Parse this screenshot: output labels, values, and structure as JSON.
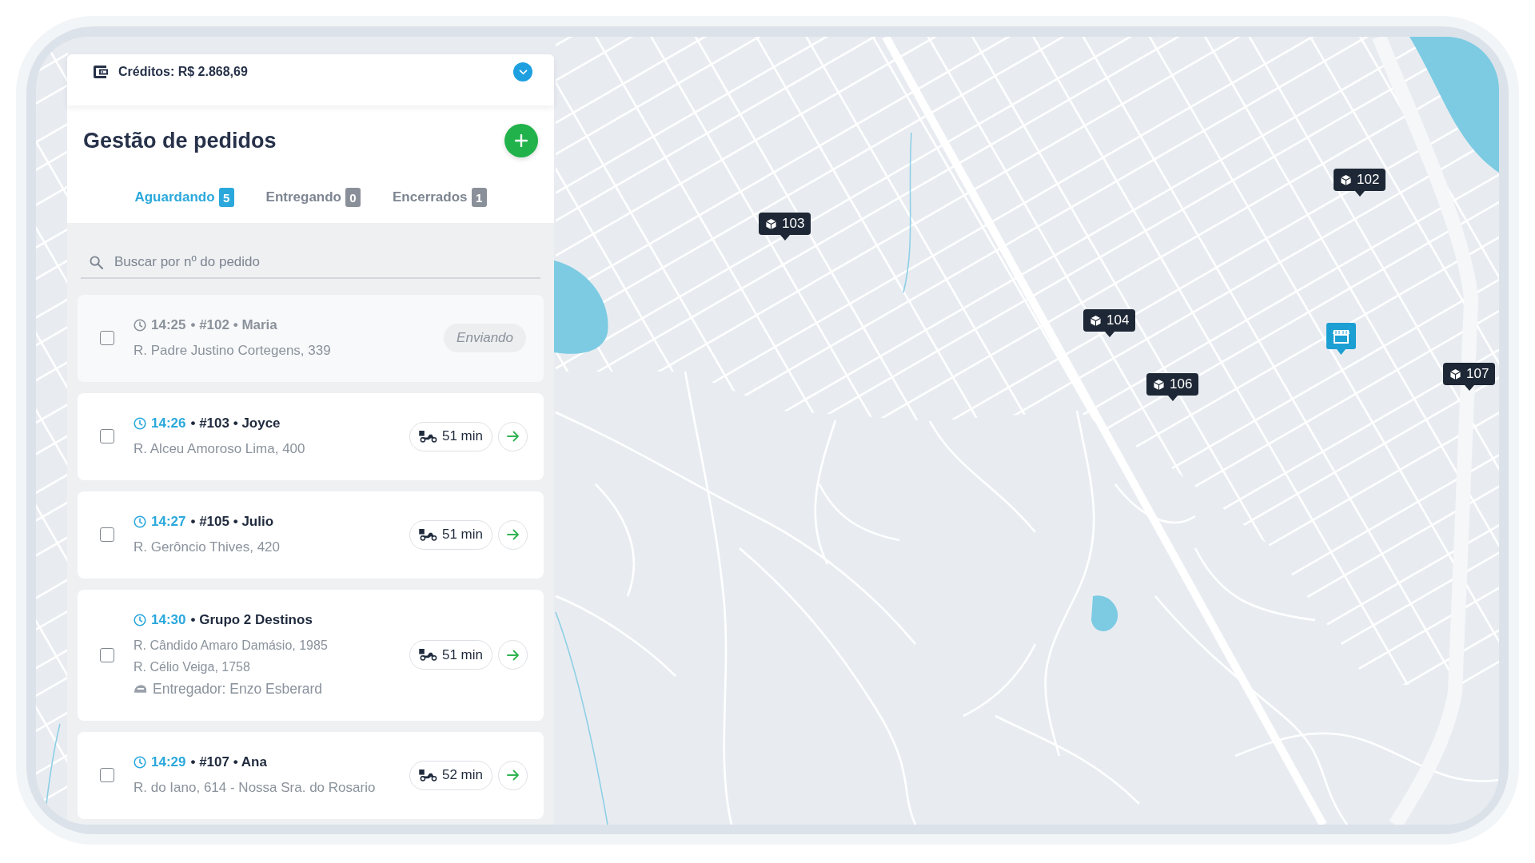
{
  "credits": {
    "label": "Créditos: R$ 2.868,69"
  },
  "header": {
    "title": "Gestão de pedidos"
  },
  "tabs": [
    {
      "label": "Aguardando",
      "count": "5",
      "selected": true
    },
    {
      "label": "Entregando",
      "count": "0",
      "selected": false
    },
    {
      "label": "Encerrados",
      "count": "1",
      "selected": false
    }
  ],
  "search": {
    "placeholder": "Buscar por nº do pedido"
  },
  "orders": [
    {
      "kind": "sending",
      "checked": false,
      "time": "14:25",
      "title": "• #102 • Maria",
      "addresses": [
        "R. Padre Justino Cortegens, 339"
      ],
      "status": "Enviando"
    },
    {
      "kind": "eta",
      "checked": false,
      "time": "14:26",
      "title": "• #103 • Joyce",
      "addresses": [
        "R. Alceu Amoroso Lima, 400"
      ],
      "eta": "51 min"
    },
    {
      "kind": "eta",
      "checked": false,
      "time": "14:27",
      "title": "• #105 • Julio",
      "addresses": [
        "R. Gerôncio Thives, 420"
      ],
      "eta": "51 min"
    },
    {
      "kind": "eta",
      "checked": false,
      "time": "14:30",
      "title": "• Grupo 2 Destinos",
      "addresses": [
        "R. Cândido Amaro Damásio, 1985",
        "R. Célio Veiga, 1758"
      ],
      "courier": "Entregador: Enzo Esberard",
      "eta": "51 min"
    },
    {
      "kind": "eta",
      "checked": false,
      "time": "14:29",
      "title": "• #107 • Ana",
      "addresses": [
        "R. do Iano, 614 - Nossa Sra. do Rosario"
      ],
      "eta": "52 min"
    }
  ],
  "map": {
    "pins": [
      {
        "kind": "order",
        "label": "103"
      },
      {
        "kind": "order",
        "label": "102"
      },
      {
        "kind": "order",
        "label": "104"
      },
      {
        "kind": "order",
        "label": "106"
      },
      {
        "kind": "order",
        "label": "107"
      },
      {
        "kind": "store"
      }
    ]
  }
}
